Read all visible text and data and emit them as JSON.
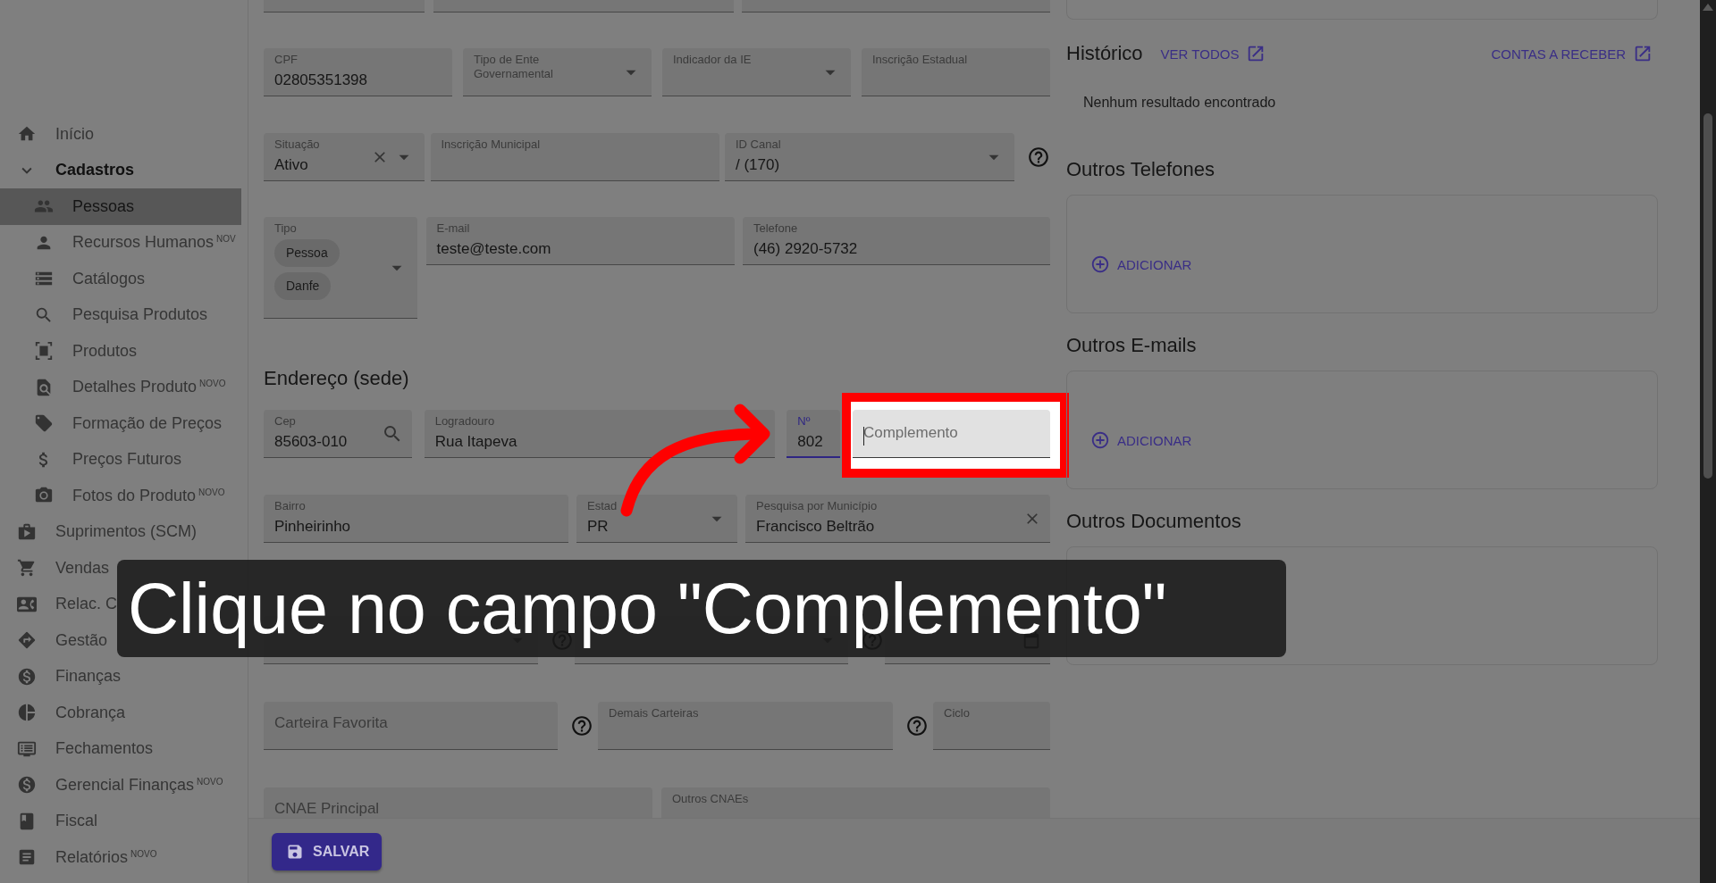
{
  "sidebar": {
    "items": [
      {
        "label": "Início",
        "selected": false
      },
      {
        "label": "Cadastros",
        "selected": false,
        "expanded": true,
        "children": [
          {
            "label": "Pessoas",
            "selected": true
          },
          {
            "label": "Recursos Humanos",
            "badge": "NOV",
            "selected": false
          },
          {
            "label": "Catálogos",
            "selected": false
          },
          {
            "label": "Pesquisa Produtos",
            "selected": false
          },
          {
            "label": "Produtos",
            "selected": false
          },
          {
            "label": "Detalhes Produto",
            "badge": "NOVO",
            "selected": false
          },
          {
            "label": "Formação de Preços",
            "selected": false
          },
          {
            "label": "Preços Futuros",
            "selected": false
          },
          {
            "label": "Fotos do Produto",
            "badge": "NOVO",
            "selected": false
          }
        ]
      },
      {
        "label": "Suprimentos (SCM)",
        "selected": false
      },
      {
        "label": "Vendas",
        "selected": false
      },
      {
        "label": "Relac. C",
        "selected": false
      },
      {
        "label": "Gestão",
        "selected": false
      },
      {
        "label": "Finanças",
        "selected": false
      },
      {
        "label": "Cobrança",
        "selected": false
      },
      {
        "label": "Fechamentos",
        "selected": false
      },
      {
        "label": "Gerencial Finanças",
        "badge": "NOVO",
        "selected": false
      },
      {
        "label": "Fiscal",
        "selected": false
      },
      {
        "label": "Relatórios",
        "badge": "NOVO",
        "selected": false
      }
    ]
  },
  "form": {
    "rows": [
      {
        "kind": "fields",
        "fields": [
          {
            "kind": "text"
          },
          {
            "kind": "text"
          },
          {
            "kind": "text"
          }
        ]
      },
      {
        "kind": "fields",
        "fields": [
          {
            "kind": "text",
            "label": "CPF",
            "value": "02805351398"
          },
          {
            "kind": "select",
            "label": "Tipo de Ente Governamental"
          },
          {
            "kind": "select",
            "label": "Indicador da IE"
          },
          {
            "kind": "text",
            "label": "Inscrição Estadual"
          }
        ]
      },
      {
        "kind": "fields",
        "fields": [
          {
            "kind": "select",
            "label": "Situação",
            "value": "Ativo",
            "clearable": true
          },
          {
            "kind": "text",
            "label": "Inscrição Municipal"
          },
          {
            "kind": "select",
            "label": "ID Canal",
            "value": "/ (170)",
            "help": true
          }
        ]
      },
      {
        "kind": "fields",
        "fields": [
          {
            "kind": "chips",
            "label": "Tipo",
            "chips": [
              "Pessoa",
              "Danfe"
            ]
          },
          {
            "kind": "text",
            "label": "E-mail",
            "value": "teste@teste.com"
          },
          {
            "kind": "text",
            "label": "Telefone",
            "value": "(46) 2920-5732"
          }
        ]
      },
      {
        "kind": "heading",
        "text": "Endereço (sede)"
      },
      {
        "kind": "fields",
        "fields": [
          {
            "kind": "search",
            "label": "Cep",
            "value": "85603-010"
          },
          {
            "kind": "text",
            "label": "Logradouro",
            "value": "Rua Itapeva"
          },
          {
            "kind": "text",
            "label": "Nº",
            "value": "802",
            "focused": true
          },
          {
            "kind": "text",
            "placeholder": "Complemento",
            "highlighted": true
          }
        ]
      },
      {
        "kind": "fields",
        "fields": [
          {
            "kind": "text",
            "label": "Bairro",
            "value": "Pinheirinho"
          },
          {
            "kind": "select",
            "label": "Estad",
            "value": "PR"
          },
          {
            "kind": "text",
            "label": "Pesquisa por Município",
            "value": "Francisco Beltrão",
            "clearable": true
          }
        ]
      },
      {
        "kind": "fields",
        "fields": [
          {
            "kind": "select",
            "help": true
          },
          {
            "kind": "select",
            "help": true
          },
          {
            "kind": "date"
          }
        ]
      },
      {
        "kind": "fields",
        "fields": [
          {
            "kind": "text",
            "placeholder": "Carteira Favorita",
            "help": true
          },
          {
            "kind": "text",
            "label": "Demais Carteiras",
            "help": true
          },
          {
            "kind": "text",
            "label": "Ciclo"
          }
        ]
      },
      {
        "kind": "fields",
        "fields": [
          {
            "kind": "text",
            "placeholder": "CNAE Principal"
          },
          {
            "kind": "text",
            "label": "Outros CNAEs"
          }
        ]
      }
    ]
  },
  "panel": {
    "history": {
      "title": "Histórico",
      "links": [
        "VER TODOS",
        "CONTAS A RECEBER"
      ],
      "empty": "Nenhum resultado encontrado"
    },
    "lists": [
      {
        "title": "Outros Telefones",
        "action": "ADICIONAR"
      },
      {
        "title": "Outros E-mails",
        "action": "ADICIONAR"
      },
      {
        "title": "Outros Documentos"
      }
    ]
  },
  "footer": {
    "save_button": "SALVAR"
  },
  "tour": {
    "caption": "Clique no campo \"Complemento\"",
    "arrow": true
  }
}
